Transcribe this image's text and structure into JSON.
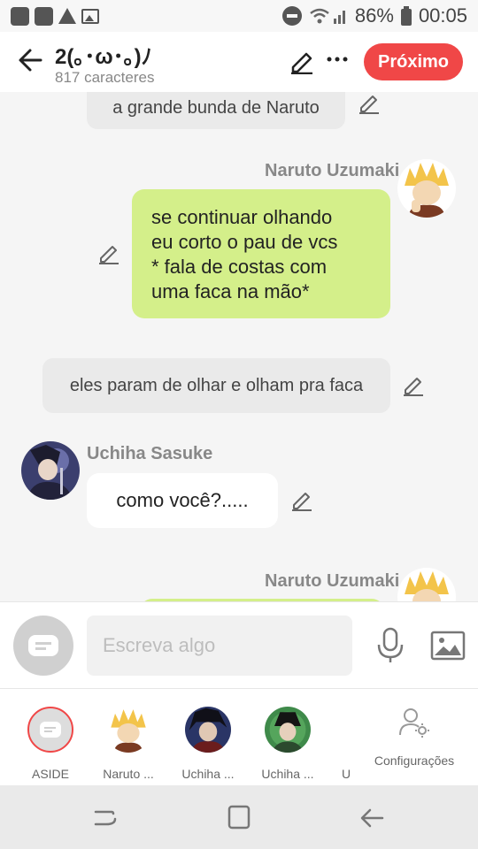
{
  "status_bar": {
    "battery": "86%",
    "time": "00:05"
  },
  "header": {
    "title": "2(｡･ω･｡)ﾉ",
    "subtitle": "817 caracteres",
    "next_label": "Próximo",
    "accent_color": "#f04747"
  },
  "messages": [
    {
      "type": "narration",
      "text": "a grande bunda de Naruto"
    },
    {
      "type": "character",
      "side": "right",
      "author": "Naruto Uzumaki",
      "lines": [
        "se continuar olhando",
        "eu corto o pau de vcs",
        "* fala de costas com",
        "uma faca na mão*"
      ]
    },
    {
      "type": "narration",
      "text": "eles param de olhar e olham pra faca"
    },
    {
      "type": "character",
      "side": "left",
      "author": "Uchiha Sasuke",
      "text": "como você?....."
    },
    {
      "type": "character",
      "side": "right",
      "author": "Naruto Uzumaki",
      "text": ""
    }
  ],
  "composer": {
    "placeholder": "Escreva algo"
  },
  "characters_bar": {
    "items": [
      {
        "label": "ASIDE",
        "icon": "chat-bubble-icon"
      },
      {
        "label": "Naruto ..."
      },
      {
        "label": "Uchiha ..."
      },
      {
        "label": "Uchiha ..."
      },
      {
        "label": "U"
      }
    ],
    "settings_label": "Configurações"
  }
}
